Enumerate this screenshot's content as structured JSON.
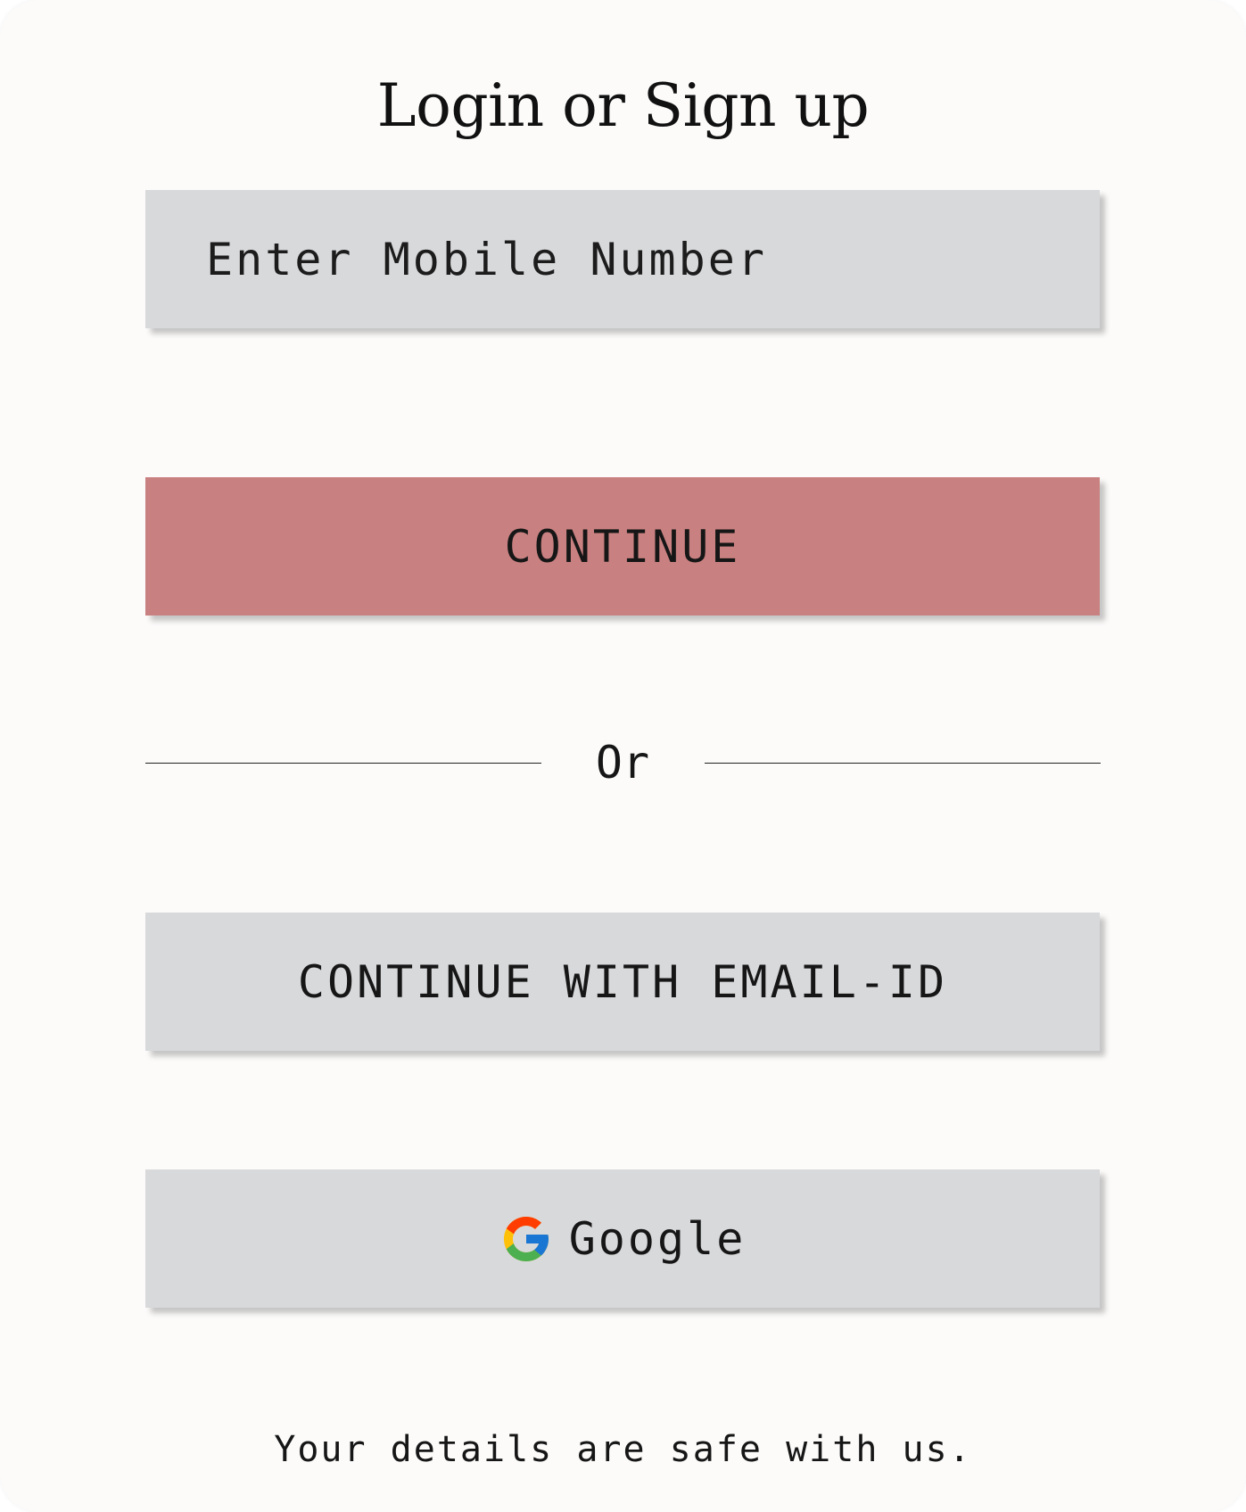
{
  "title": "Login or Sign up",
  "mobile_input": {
    "placeholder": "Enter Mobile Number",
    "value": ""
  },
  "continue_button": {
    "label": "CONTINUE",
    "color": "#c98080"
  },
  "divider": {
    "label": "Or"
  },
  "email_button": {
    "label": "CONTINUE WITH EMAIL-ID"
  },
  "google_button": {
    "icon": "google-logo-icon",
    "label": "Google"
  },
  "footer": {
    "text": "Your details are safe with us."
  },
  "colors": {
    "background": "#fcfbfa",
    "field_background": "#d8d9db",
    "accent": "#c98080",
    "text": "#161616"
  }
}
